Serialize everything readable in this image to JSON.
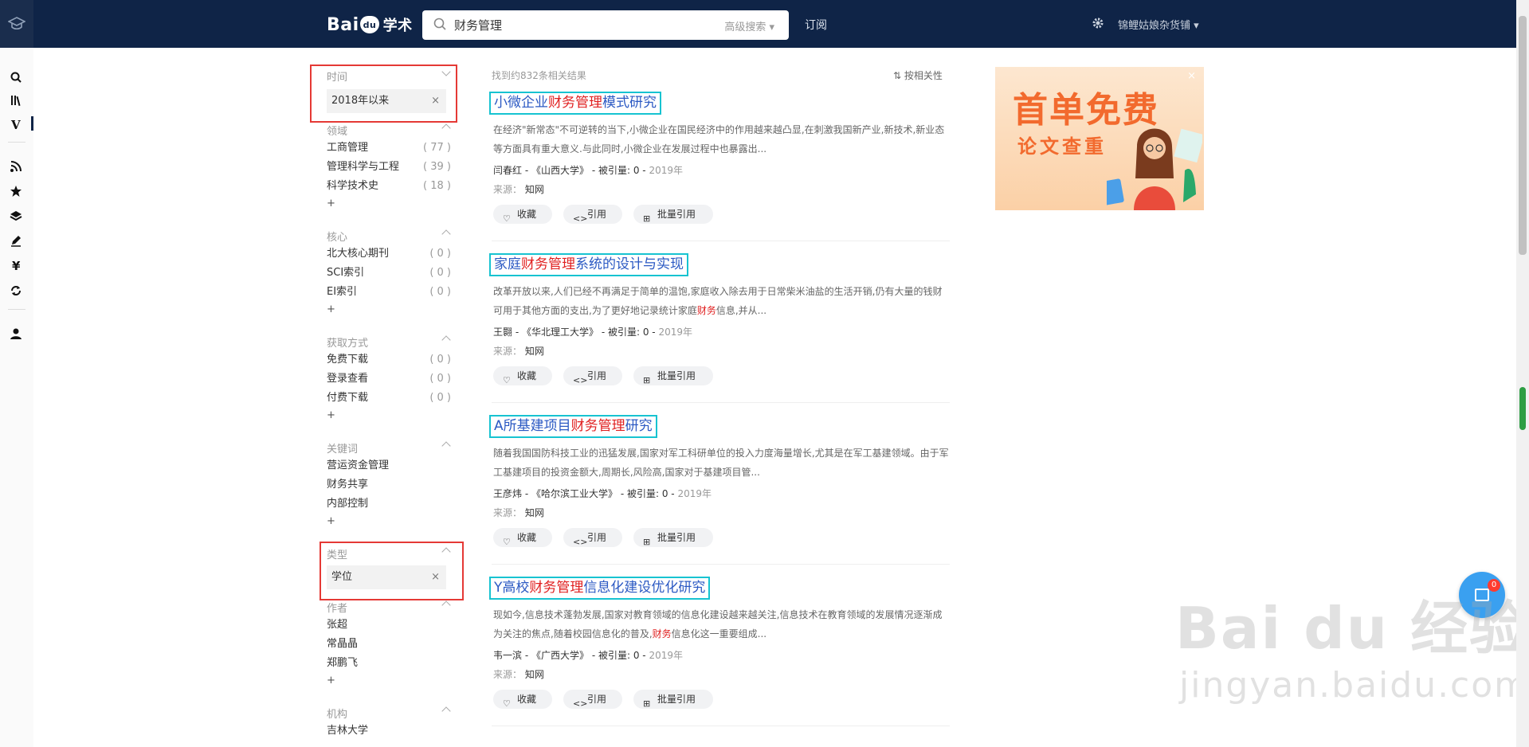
{
  "topbar": {
    "logo": {
      "left": "Bai",
      "mid": "du",
      "right": "学术"
    },
    "search_value": "财务管理",
    "advanced_search": "高级搜索 ▾",
    "subscribe": "订阅",
    "user": "锦鲤姑娘杂货铺 ▾"
  },
  "filters": {
    "time": {
      "title": "时间",
      "chip": "2018年以来",
      "remove": "×"
    },
    "field": {
      "title": "领域",
      "items": [
        {
          "label": "工商管理",
          "count": "( 77 )"
        },
        {
          "label": "管理科学与工程",
          "count": "( 39 )"
        },
        {
          "label": "科学技术史",
          "count": "( 18 )"
        }
      ],
      "more": "+"
    },
    "core": {
      "title": "核心",
      "items": [
        {
          "label": "北大核心期刊",
          "count": "( 0 )"
        },
        {
          "label": "SCI索引",
          "count": "( 0 )"
        },
        {
          "label": "EI索引",
          "count": "( 0 )"
        }
      ],
      "more": "+"
    },
    "access": {
      "title": "获取方式",
      "items": [
        {
          "label": "免费下载",
          "count": "( 0 )"
        },
        {
          "label": "登录查看",
          "count": "( 0 )"
        },
        {
          "label": "付费下载",
          "count": "( 0 )"
        }
      ],
      "more": "+"
    },
    "keywords": {
      "title": "关键词",
      "items": [
        {
          "label": "营运资金管理"
        },
        {
          "label": "财务共享"
        },
        {
          "label": "内部控制"
        }
      ],
      "more": "+"
    },
    "type": {
      "title": "类型",
      "chip": "学位",
      "remove": "×"
    },
    "author": {
      "title": "作者",
      "items": [
        {
          "label": "张超"
        },
        {
          "label": "常晶晶"
        },
        {
          "label": "郑鹏飞"
        }
      ],
      "more": "+"
    },
    "institution": {
      "title": "机构",
      "items": [
        {
          "label": "吉林大学"
        }
      ]
    }
  },
  "results_header": {
    "count": "找到约832条相关结果",
    "sort": "按相关性"
  },
  "results": [
    {
      "title_pre": "小微企业",
      "title_hl": "财务管理",
      "title_post": "模式研究",
      "abstract": "在经济\"新常态\"不可逆转的当下,小微企业在国民经济中的作用越来越凸显,在刺激我国新产业,新技术,新业态等方面具有重大意义.与此同时,小微企业在发展过程中也暴露出...",
      "author": "闫春红",
      "journal": "《山西大学》",
      "cite_label": "被引量:",
      "cite": "0",
      "year": "2019年",
      "source_label": "来源：",
      "source": "知网"
    },
    {
      "title_pre": "家庭",
      "title_hl": "财务管理",
      "title_post": "系统的设计与实现",
      "abstract_pre": "改革开放以来,人们已经不再满足于简单的温饱,家庭收入除去用于日常柴米油盐的生活开销,仍有大量的钱财可用于其他方面的支出,为了更好地记录统计家庭",
      "abstract_hl": "财务",
      "abstract_post": "信息,并从...",
      "author": "王翾",
      "journal": "《华北理工大学》",
      "cite_label": "被引量:",
      "cite": "0",
      "year": "2019年",
      "source_label": "来源：",
      "source": "知网"
    },
    {
      "title_pre": "A所基建项目",
      "title_hl": "财务管理",
      "title_post": "研究",
      "abstract": "随着我国国防科技工业的迅猛发展,国家对军工科研单位的投入力度海量增长,尤其是在军工基建领域。由于军工基建项目的投资金额大,周期长,风险高,国家对于基建项目管...",
      "author": "王彦炜",
      "journal": "《哈尔滨工业大学》",
      "cite_label": "被引量:",
      "cite": "0",
      "year": "2019年",
      "source_label": "来源：",
      "source": "知网"
    },
    {
      "title_pre": "Y高校",
      "title_hl": "财务管理",
      "title_post": "信息化建设优化研究",
      "abstract_pre": "现如今,信息技术蓬勃发展,国家对教育领域的信息化建设越来越关注,信息技术在教育领域的发展情况逐渐成为关注的焦点,随着校园信息化的普及,",
      "abstract_hl": "财务",
      "abstract_post": "信息化这一重要组成...",
      "author": "韦一滨",
      "journal": "《广西大学》",
      "cite_label": "被引量:",
      "cite": "0",
      "year": "2019年",
      "source_label": "来源：",
      "source": "知网"
    }
  ],
  "actions": {
    "collect": "收藏",
    "cite": "引用",
    "batch_cite": "批量引用"
  },
  "ad": {
    "line1": "首单免费",
    "line2": "论文查重",
    "close": "×"
  },
  "fab_badge": "0",
  "watermark": {
    "line1": "Bai du 经验",
    "line2": "jingyan.baidu.com"
  },
  "colors": {
    "topbar": "#0f2447",
    "link": "#2b59c3",
    "highlight": "#e02020",
    "annotation_cyan": "#17c3d1",
    "annotation_red": "#e53935"
  }
}
